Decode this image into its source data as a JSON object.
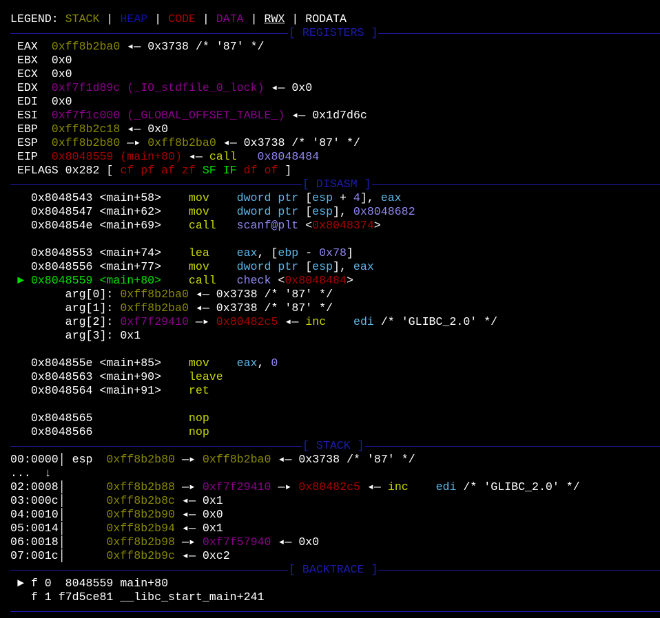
{
  "palette": {
    "w": "#ffffff",
    "y": "#8a8a00",
    "b": "#1010a8",
    "r": "#a80000",
    "p": "#8b008b",
    "g": "#00e000",
    "m": "#c8d800",
    "c": "#5fb8e8",
    "l": "#9088f0"
  },
  "lines": [
    {
      "segs": [
        [
          "LEGEND: ",
          "w"
        ],
        [
          "STACK",
          "y"
        ],
        [
          " | ",
          "w"
        ],
        [
          "HEAP",
          "b"
        ],
        [
          " | ",
          "w"
        ],
        [
          "CODE",
          "r"
        ],
        [
          " | ",
          "w"
        ],
        [
          "DATA",
          "p"
        ],
        [
          " | ",
          "w"
        ],
        [
          "RWX",
          "w",
          1
        ],
        [
          " | RODATA",
          "w"
        ]
      ]
    },
    {
      "header": "[ REGISTERS ]"
    },
    {
      "segs": [
        [
          " EAX  ",
          "w"
        ],
        [
          "0xff8b2ba0",
          "y"
        ],
        [
          " ◂— 0x3738 /* '87' */",
          "w"
        ]
      ]
    },
    {
      "segs": [
        [
          " EBX  0x0",
          "w"
        ]
      ]
    },
    {
      "segs": [
        [
          " ECX  0x0",
          "w"
        ]
      ]
    },
    {
      "segs": [
        [
          " EDX  ",
          "w"
        ],
        [
          "0xf7f1d89c (_IO_stdfile_0_lock)",
          "p"
        ],
        [
          " ◂— 0x0",
          "w"
        ]
      ]
    },
    {
      "segs": [
        [
          " EDI  0x0",
          "w"
        ]
      ]
    },
    {
      "segs": [
        [
          " ESI  ",
          "w"
        ],
        [
          "0xf7f1c000 (_GLOBAL_OFFSET_TABLE_)",
          "p"
        ],
        [
          " ◂— 0x1d7d6c",
          "w"
        ]
      ]
    },
    {
      "segs": [
        [
          " EBP  ",
          "w"
        ],
        [
          "0xff8b2c18",
          "y"
        ],
        [
          " ◂— 0x0",
          "w"
        ]
      ]
    },
    {
      "segs": [
        [
          " ESP  ",
          "w"
        ],
        [
          "0xff8b2b80",
          "y"
        ],
        [
          " —▸ ",
          "w"
        ],
        [
          "0xff8b2ba0",
          "y"
        ],
        [
          " ◂— 0x3738 /* '87' */",
          "w"
        ]
      ]
    },
    {
      "segs": [
        [
          " EIP  ",
          "w"
        ],
        [
          "0x8048559 (main+80)",
          "r"
        ],
        [
          " ◂— ",
          "w"
        ],
        [
          "call",
          "m"
        ],
        [
          "   ",
          "w"
        ],
        [
          "0x8048484",
          "l"
        ]
      ]
    },
    {
      "segs": [
        [
          " EFLAGS 0x282 [ ",
          "w"
        ],
        [
          "cf pf af zf",
          "r"
        ],
        [
          " ",
          "w"
        ],
        [
          "SF IF",
          "g"
        ],
        [
          " ",
          "w"
        ],
        [
          "df of",
          "r"
        ],
        [
          " ]",
          "w"
        ]
      ]
    },
    {
      "header": "[ DISASM ]"
    },
    {
      "segs": [
        [
          "   0x8048543 <main+58>    ",
          "w"
        ],
        [
          "mov",
          "m"
        ],
        [
          "    ",
          "w"
        ],
        [
          "dword ptr",
          "c"
        ],
        [
          " [",
          "w"
        ],
        [
          "esp",
          "c"
        ],
        [
          " + ",
          "w"
        ],
        [
          "4",
          "l"
        ],
        [
          "], ",
          "w"
        ],
        [
          "eax",
          "c"
        ]
      ]
    },
    {
      "segs": [
        [
          "   0x8048547 <main+62>    ",
          "w"
        ],
        [
          "mov",
          "m"
        ],
        [
          "    ",
          "w"
        ],
        [
          "dword ptr",
          "c"
        ],
        [
          " [",
          "w"
        ],
        [
          "esp",
          "c"
        ],
        [
          "], ",
          "w"
        ],
        [
          "0x8048682",
          "l"
        ]
      ]
    },
    {
      "segs": [
        [
          "   0x804854e <main+69>    ",
          "w"
        ],
        [
          "call",
          "m"
        ],
        [
          "   ",
          "w"
        ],
        [
          "scanf@plt",
          "l"
        ],
        [
          " <",
          "w"
        ],
        [
          "0x8048374",
          "r"
        ],
        [
          ">",
          "w"
        ]
      ]
    },
    {
      "segs": []
    },
    {
      "segs": [
        [
          "   0x8048553 <main+74>    ",
          "w"
        ],
        [
          "lea",
          "m"
        ],
        [
          "    ",
          "w"
        ],
        [
          "eax",
          "c"
        ],
        [
          ", [",
          "w"
        ],
        [
          "ebp",
          "c"
        ],
        [
          " - ",
          "w"
        ],
        [
          "0x78",
          "l"
        ],
        [
          "]",
          "w"
        ]
      ]
    },
    {
      "segs": [
        [
          "   0x8048556 <main+77>    ",
          "w"
        ],
        [
          "mov",
          "m"
        ],
        [
          "    ",
          "w"
        ],
        [
          "dword ptr",
          "c"
        ],
        [
          " [",
          "w"
        ],
        [
          "esp",
          "c"
        ],
        [
          "], ",
          "w"
        ],
        [
          "eax",
          "c"
        ]
      ]
    },
    {
      "segs": [
        [
          " ► 0x8048559 <main+80>    ",
          "g"
        ],
        [
          "call",
          "m"
        ],
        [
          "   ",
          "w"
        ],
        [
          "check",
          "l"
        ],
        [
          " <",
          "w"
        ],
        [
          "0x8048484",
          "r"
        ],
        [
          ">",
          "w"
        ]
      ]
    },
    {
      "segs": [
        [
          "        arg[0]: ",
          "w"
        ],
        [
          "0xff8b2ba0",
          "y"
        ],
        [
          " ◂— 0x3738 /* '87' */",
          "w"
        ]
      ]
    },
    {
      "segs": [
        [
          "        arg[1]: ",
          "w"
        ],
        [
          "0xff8b2ba0",
          "y"
        ],
        [
          " ◂— 0x3738 /* '87' */",
          "w"
        ]
      ]
    },
    {
      "segs": [
        [
          "        arg[2]: ",
          "w"
        ],
        [
          "0xf7f29410",
          "p"
        ],
        [
          " —▸ ",
          "w"
        ],
        [
          "0x80482c5",
          "r"
        ],
        [
          " ◂— ",
          "w"
        ],
        [
          "inc",
          "m"
        ],
        [
          "    ",
          "w"
        ],
        [
          "edi",
          "c"
        ],
        [
          " /* 'GLIBC_2.0' */",
          "w"
        ]
      ]
    },
    {
      "segs": [
        [
          "        arg[3]: 0x1",
          "w"
        ]
      ]
    },
    {
      "segs": []
    },
    {
      "segs": [
        [
          "   0x804855e <main+85>    ",
          "w"
        ],
        [
          "mov",
          "m"
        ],
        [
          "    ",
          "w"
        ],
        [
          "eax",
          "c"
        ],
        [
          ", ",
          "w"
        ],
        [
          "0",
          "l"
        ]
      ]
    },
    {
      "segs": [
        [
          "   0x8048563 <main+90>    ",
          "w"
        ],
        [
          "leave",
          "m"
        ]
      ]
    },
    {
      "segs": [
        [
          "   0x8048564 <main+91>    ",
          "w"
        ],
        [
          "ret",
          "m"
        ]
      ]
    },
    {
      "segs": []
    },
    {
      "segs": [
        [
          "   0x8048565              ",
          "w"
        ],
        [
          "nop",
          "m"
        ]
      ]
    },
    {
      "segs": [
        [
          "   0x8048566              ",
          "w"
        ],
        [
          "nop",
          "m"
        ]
      ]
    },
    {
      "header": "[ STACK ]"
    },
    {
      "segs": [
        [
          "00:0000│ esp  ",
          "w"
        ],
        [
          "0xff8b2b80",
          "y"
        ],
        [
          " —▸ ",
          "w"
        ],
        [
          "0xff8b2ba0",
          "y"
        ],
        [
          " ◂— 0x3738 /* '87' */",
          "w"
        ]
      ]
    },
    {
      "segs": [
        [
          "...  ↓",
          "w"
        ]
      ]
    },
    {
      "segs": [
        [
          "02:0008│      ",
          "w"
        ],
        [
          "0xff8b2b88",
          "y"
        ],
        [
          " —▸ ",
          "w"
        ],
        [
          "0xf7f29410",
          "p"
        ],
        [
          " —▸ ",
          "w"
        ],
        [
          "0x80482c5",
          "r"
        ],
        [
          " ◂— ",
          "w"
        ],
        [
          "inc",
          "m"
        ],
        [
          "    ",
          "w"
        ],
        [
          "edi",
          "c"
        ],
        [
          " /* 'GLIBC_2.0' */",
          "w"
        ]
      ]
    },
    {
      "segs": [
        [
          "03:000c│      ",
          "w"
        ],
        [
          "0xff8b2b8c",
          "y"
        ],
        [
          " ◂— 0x1",
          "w"
        ]
      ]
    },
    {
      "segs": [
        [
          "04:0010│      ",
          "w"
        ],
        [
          "0xff8b2b90",
          "y"
        ],
        [
          " ◂— 0x0",
          "w"
        ]
      ]
    },
    {
      "segs": [
        [
          "05:0014│      ",
          "w"
        ],
        [
          "0xff8b2b94",
          "y"
        ],
        [
          " ◂— 0x1",
          "w"
        ]
      ]
    },
    {
      "segs": [
        [
          "06:0018│      ",
          "w"
        ],
        [
          "0xff8b2b98",
          "y"
        ],
        [
          " —▸ ",
          "w"
        ],
        [
          "0xf7f57940",
          "p"
        ],
        [
          " ◂— 0x0",
          "w"
        ]
      ]
    },
    {
      "segs": [
        [
          "07:001c│      ",
          "w"
        ],
        [
          "0xff8b2b9c",
          "y"
        ],
        [
          " ◂— 0xc2",
          "w"
        ]
      ]
    },
    {
      "header": "[ BACKTRACE ]"
    },
    {
      "segs": [
        [
          " ► f 0  8048559 main+80",
          "w"
        ]
      ]
    },
    {
      "segs": [
        [
          "   f 1 f7d5ce81 __libc_start_main+241",
          "w"
        ]
      ]
    },
    {
      "header": ""
    }
  ]
}
